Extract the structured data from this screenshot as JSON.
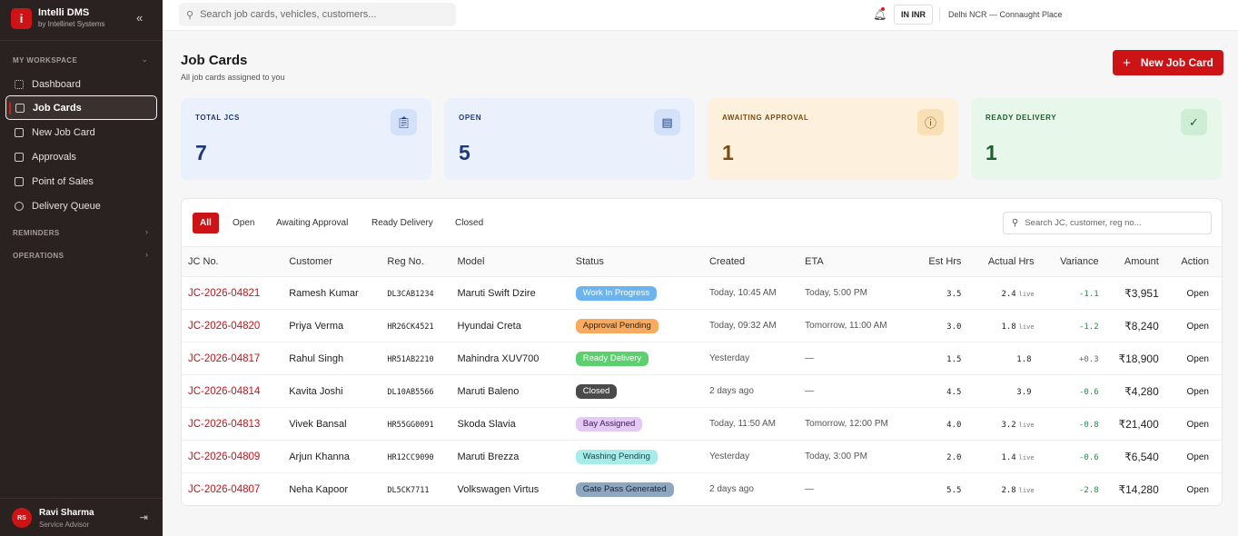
{
  "brand": {
    "logo_letter": "i",
    "name": "Intelli DMS",
    "sub": "by Intellinet Systems",
    "collapse_icon": "double-chevron-left-icon"
  },
  "sidebar": {
    "section_workspace": "MY WORKSPACE",
    "items": [
      {
        "label": "Dashboard",
        "icon": "grid-icon",
        "active": false
      },
      {
        "label": "Job Cards",
        "icon": "clipboard-icon",
        "active": true
      },
      {
        "label": "New Job Card",
        "icon": "file-plus-icon",
        "active": false
      },
      {
        "label": "Approvals",
        "icon": "check-square-icon",
        "active": false
      },
      {
        "label": "Point of Sales",
        "icon": "receipt-icon",
        "active": false
      },
      {
        "label": "Delivery Queue",
        "icon": "package-icon",
        "active": false
      }
    ],
    "section_reminders": "REMINDERS",
    "section_operations": "OPERATIONS"
  },
  "user": {
    "initials": "RS",
    "name": "Ravi Sharma",
    "role": "Service Advisor"
  },
  "topbar": {
    "search_placeholder": "Search job cards, vehicles, customers...",
    "currency": "IN INR",
    "location": "Delhi NCR — Connaught Place"
  },
  "page": {
    "title": "Job Cards",
    "subtitle": "All job cards assigned to you",
    "new_button": "New Job Card"
  },
  "stats": [
    {
      "label": "TOTAL JCS",
      "value": "7",
      "icon": "clipboard-icon",
      "bg": "#eaf1fd",
      "fg": "#1f3a7a",
      "icon_bg": "#d4e2f9"
    },
    {
      "label": "OPEN",
      "value": "5",
      "icon": "document-icon",
      "bg": "#eaf1fd",
      "fg": "#1f3a7a",
      "icon_bg": "#d4e2f9"
    },
    {
      "label": "AWAITING APPROVAL",
      "value": "1",
      "icon": "alert-circle-icon",
      "bg": "#fdf1dd",
      "fg": "#7a4d12",
      "icon_bg": "#f8dfb5"
    },
    {
      "label": "READY DELIVERY",
      "value": "1",
      "icon": "check-circle-icon",
      "bg": "#e7f7ea",
      "fg": "#1e5e2f",
      "icon_bg": "#cdeed4"
    }
  ],
  "filters": [
    "All",
    "Open",
    "Awaiting Approval",
    "Ready Delivery",
    "Closed"
  ],
  "table_search_placeholder": "Search JC, customer, reg no...",
  "columns": [
    "JC No.",
    "Customer",
    "Reg No.",
    "Model",
    "Status",
    "Created",
    "ETA",
    "Est Hrs",
    "Actual Hrs",
    "Variance",
    "Amount",
    "Action"
  ],
  "rows": [
    {
      "jc": "JC-2026-04821",
      "customer": "Ramesh Kumar",
      "reg": "DL3CAB1234",
      "model": "Maruti Swift Dzire",
      "status": "Work In Progress",
      "status_bg": "#6cb4ef",
      "status_fg": "#ffffff",
      "created": "Today, 10:45 AM",
      "eta": "Today, 5:00 PM",
      "est": "3.5",
      "actual": "2.4",
      "live": "live",
      "variance": "-1.1",
      "amount": "₹3,951",
      "action": "Open"
    },
    {
      "jc": "JC-2026-04820",
      "customer": "Priya Verma",
      "reg": "HR26CK4521",
      "model": "Hyundai Creta",
      "status": "Approval Pending",
      "status_bg": "#f8aa60",
      "status_fg": "#3a2208",
      "created": "Today, 09:32 AM",
      "eta": "Tomorrow, 11:00 AM",
      "est": "3.0",
      "actual": "1.8",
      "live": "live",
      "variance": "-1.2",
      "amount": "₹8,240",
      "action": "Open"
    },
    {
      "jc": "JC-2026-04817",
      "customer": "Rahul Singh",
      "reg": "HR51AB2210",
      "model": "Mahindra XUV700",
      "status": "Ready Delivery",
      "status_bg": "#5ccf6e",
      "status_fg": "#ffffff",
      "created": "Yesterday",
      "eta": "—",
      "est": "1.5",
      "actual": "1.8",
      "live": "",
      "variance": "+0.3",
      "amount": "₹18,900",
      "action": "Open"
    },
    {
      "jc": "JC-2026-04814",
      "customer": "Kavita Joshi",
      "reg": "DL10AB5566",
      "model": "Maruti Baleno",
      "status": "Closed",
      "status_bg": "#4a4a4a",
      "status_fg": "#ffffff",
      "created": "2 days ago",
      "eta": "—",
      "est": "4.5",
      "actual": "3.9",
      "live": "",
      "variance": "-0.6",
      "amount": "₹4,280",
      "action": "Open"
    },
    {
      "jc": "JC-2026-04813",
      "customer": "Vivek Bansal",
      "reg": "HR55GG0091",
      "model": "Skoda Slavia",
      "status": "Bay Assigned",
      "status_bg": "#e4c9f5",
      "status_fg": "#3b2052",
      "created": "Today, 11:50 AM",
      "eta": "Tomorrow, 12:00 PM",
      "est": "4.0",
      "actual": "3.2",
      "live": "live",
      "variance": "-0.8",
      "amount": "₹21,400",
      "action": "Open"
    },
    {
      "jc": "JC-2026-04809",
      "customer": "Arjun Khanna",
      "reg": "HR12CC9090",
      "model": "Maruti Brezza",
      "status": "Washing Pending",
      "status_bg": "#a6ece8",
      "status_fg": "#184846",
      "created": "Yesterday",
      "eta": "Today, 3:00 PM",
      "est": "2.0",
      "actual": "1.4",
      "live": "live",
      "variance": "-0.6",
      "amount": "₹6,540",
      "action": "Open"
    },
    {
      "jc": "JC-2026-04807",
      "customer": "Neha Kapoor",
      "reg": "DL5CK7711",
      "model": "Volkswagen Virtus",
      "status": "Gate Pass Generated",
      "status_bg": "#8ea6bf",
      "status_fg": "#152535",
      "created": "2 days ago",
      "eta": "—",
      "est": "5.5",
      "actual": "2.8",
      "live": "live",
      "variance": "-2.8",
      "amount": "₹14,280",
      "action": "Open"
    }
  ]
}
